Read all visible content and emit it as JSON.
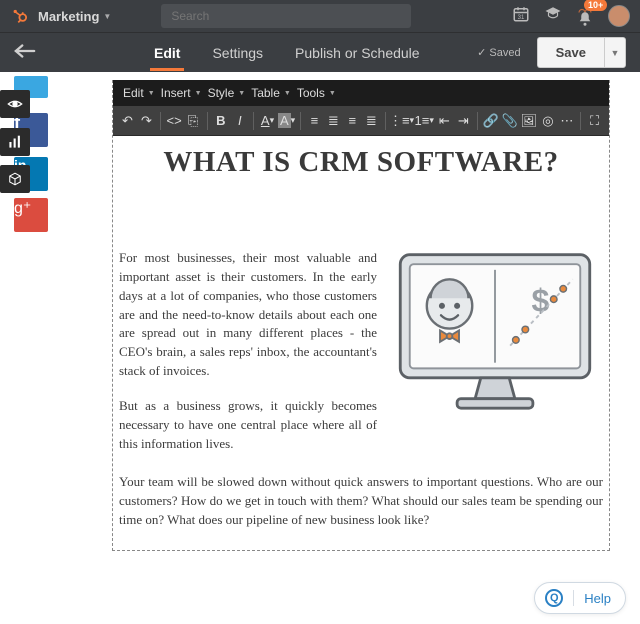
{
  "topbar": {
    "brand": "Marketing",
    "search_placeholder": "Search",
    "notif_badge": "10+"
  },
  "toolbar": {
    "tabs": {
      "edit": "Edit",
      "settings": "Settings",
      "publish": "Publish or Schedule"
    },
    "saved_label": "✓  Saved",
    "save_label": "Save"
  },
  "editor": {
    "menus": {
      "edit": "Edit",
      "insert": "Insert",
      "style": "Style",
      "table": "Table",
      "tools": "Tools"
    }
  },
  "article": {
    "title": "WHAT IS CRM SOFTWARE?",
    "p1": "For most businesses, their most valuable and important asset is their customers. In the early days at a lot of companies, who those customers are and the need-to-know details about each one are spread out in many different places - the CEO's brain, a sales reps' inbox, the accountant's stack of invoices.",
    "p2": "But as a business grows, it quickly becomes necessary to have one central place where all of this information lives.",
    "p3": "Your team will be slowed down without quick answers to important questions. Who are our customers? How do we get in touch with them? What should our sales team be spending our time on? What does our pipeline of new business look like?"
  },
  "help": {
    "label": "Help"
  }
}
